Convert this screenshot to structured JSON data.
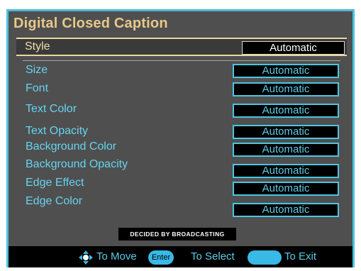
{
  "menu": {
    "title": "Digital Closed Caption",
    "style": {
      "label": "Style",
      "value": "Automatic"
    },
    "options": [
      {
        "label": "Size",
        "value": "Automatic"
      },
      {
        "label": "Font",
        "value": "Automatic"
      },
      {
        "label": "Text Color",
        "value": "Automatic"
      },
      {
        "label": "Text Opacity",
        "value": "Automatic"
      },
      {
        "label": "Background Color",
        "value": "Automatic"
      },
      {
        "label": "Background Opacity",
        "value": "Automatic"
      },
      {
        "label": "Edge Effect",
        "value": "Automatic"
      },
      {
        "label": "Edge Color",
        "value": "Automatic"
      }
    ],
    "notice": "DECIDED BY BROADCASTING"
  },
  "footer": {
    "move_label": "To Move",
    "enter_key": "Enter",
    "select_label": "To Select",
    "exit_label": "To Exit"
  },
  "colors": {
    "frame_cyan": "#49c4df",
    "title_gold": "#e8c88a",
    "option_cyan": "#65d4ef",
    "background_gray": "#4f4f4f"
  },
  "icons": {
    "move": "four-way-arrow-icon"
  }
}
